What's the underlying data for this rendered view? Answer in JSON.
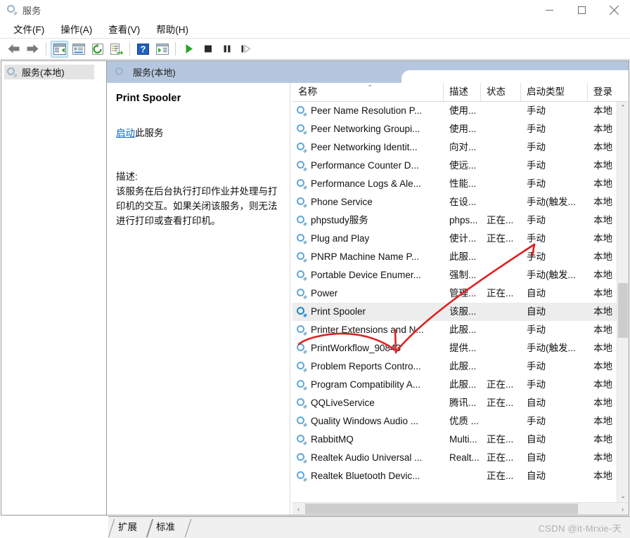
{
  "window": {
    "title": "服务",
    "icon": "gear-icon",
    "minimize_label": "最小化",
    "maximize_label": "最大化",
    "close_label": "关闭"
  },
  "menubar": {
    "items": [
      {
        "label": "文件(F)",
        "name": "menu-file"
      },
      {
        "label": "操作(A)",
        "name": "menu-action"
      },
      {
        "label": "查看(V)",
        "name": "menu-view"
      },
      {
        "label": "帮助(H)",
        "name": "menu-help"
      }
    ]
  },
  "toolbar": {
    "buttons": [
      {
        "icon": "back-arrow-icon",
        "label": "后退"
      },
      {
        "icon": "forward-arrow-icon",
        "label": "前进"
      },
      {
        "icon": "show-hide-tree-icon",
        "label": "显示/隐藏控制台树"
      },
      {
        "icon": "properties-icon",
        "label": "属性"
      },
      {
        "icon": "refresh-icon",
        "label": "刷新"
      },
      {
        "icon": "export-list-icon",
        "label": "导出列表"
      },
      {
        "icon": "help-icon",
        "label": "帮助"
      },
      {
        "icon": "show-action-pane-icon",
        "label": "显示/隐藏操作窗格"
      },
      {
        "icon": "start-service-icon",
        "label": "启动服务"
      },
      {
        "icon": "stop-service-icon",
        "label": "停止服务"
      },
      {
        "icon": "pause-service-icon",
        "label": "暂停服务"
      },
      {
        "icon": "restart-service-icon",
        "label": "重启服务"
      }
    ]
  },
  "sidebar": {
    "items": [
      {
        "label": "服务(本地)",
        "icon": "gear-icon",
        "selected": true
      }
    ]
  },
  "pane": {
    "header_title": "服务(本地)",
    "header_icon": "gear-icon"
  },
  "detail": {
    "service_name": "Print Spooler",
    "action_link": "启动",
    "action_suffix": "此服务",
    "description_label": "描述:",
    "description_text": "该服务在后台执行打印作业并处理与打印机的交互。如果关闭该服务，则无法进行打印或查看打印机。"
  },
  "list": {
    "columns": [
      {
        "key": "name",
        "label": "名称",
        "sorted": true,
        "sort_caret": "⌃"
      },
      {
        "key": "desc",
        "label": "描述"
      },
      {
        "key": "state",
        "label": "状态"
      },
      {
        "key": "start",
        "label": "启动类型"
      },
      {
        "key": "logon",
        "label": "登录"
      }
    ],
    "rows": [
      {
        "name": "Peer Name Resolution P...",
        "desc": "使用...",
        "state": "",
        "start": "手动",
        "logon": "本地",
        "selected": false
      },
      {
        "name": "Peer Networking Groupi...",
        "desc": "使用...",
        "state": "",
        "start": "手动",
        "logon": "本地",
        "selected": false
      },
      {
        "name": "Peer Networking Identit...",
        "desc": "向对...",
        "state": "",
        "start": "手动",
        "logon": "本地",
        "selected": false
      },
      {
        "name": "Performance Counter D...",
        "desc": "使远...",
        "state": "",
        "start": "手动",
        "logon": "本地",
        "selected": false
      },
      {
        "name": "Performance Logs & Ale...",
        "desc": "性能...",
        "state": "",
        "start": "手动",
        "logon": "本地",
        "selected": false
      },
      {
        "name": "Phone Service",
        "desc": "在设...",
        "state": "",
        "start": "手动(触发...",
        "logon": "本地",
        "selected": false
      },
      {
        "name": "phpstudy服务",
        "desc": "phps...",
        "state": "正在...",
        "start": "手动",
        "logon": "本地",
        "selected": false
      },
      {
        "name": "Plug and Play",
        "desc": "使计...",
        "state": "正在...",
        "start": "手动",
        "logon": "本地",
        "selected": false
      },
      {
        "name": "PNRP Machine Name P...",
        "desc": "此服...",
        "state": "",
        "start": "手动",
        "logon": "本地",
        "selected": false
      },
      {
        "name": "Portable Device Enumer...",
        "desc": "强制...",
        "state": "",
        "start": "手动(触发...",
        "logon": "本地",
        "selected": false
      },
      {
        "name": "Power",
        "desc": "管理...",
        "state": "正在...",
        "start": "自动",
        "logon": "本地",
        "selected": false
      },
      {
        "name": "Print Spooler",
        "desc": "该服...",
        "state": "",
        "start": "自动",
        "logon": "本地",
        "selected": true
      },
      {
        "name": "Printer Extensions and N...",
        "desc": "此服...",
        "state": "",
        "start": "手动",
        "logon": "本地",
        "selected": false
      },
      {
        "name": "PrintWorkflow_90843",
        "desc": "提供...",
        "state": "",
        "start": "手动(触发...",
        "logon": "本地",
        "selected": false
      },
      {
        "name": "Problem Reports Contro...",
        "desc": "此服...",
        "state": "",
        "start": "手动",
        "logon": "本地",
        "selected": false
      },
      {
        "name": "Program Compatibility A...",
        "desc": "此服...",
        "state": "正在...",
        "start": "手动",
        "logon": "本地",
        "selected": false
      },
      {
        "name": "QQLiveService",
        "desc": "腾讯...",
        "state": "正在...",
        "start": "自动",
        "logon": "本地",
        "selected": false
      },
      {
        "name": "Quality Windows Audio ...",
        "desc": "优质 ...",
        "state": "",
        "start": "手动",
        "logon": "本地",
        "selected": false
      },
      {
        "name": "RabbitMQ",
        "desc": "Multi...",
        "state": "正在...",
        "start": "自动",
        "logon": "本地",
        "selected": false
      },
      {
        "name": "Realtek Audio Universal ...",
        "desc": "Realt...",
        "state": "正在...",
        "start": "自动",
        "logon": "本地",
        "selected": false
      },
      {
        "name": "Realtek Bluetooth Devic...",
        "desc": "",
        "state": "正在...",
        "start": "自动",
        "logon": "本地",
        "selected": false
      }
    ]
  },
  "scrollbars": {
    "vertical_up": "⌃",
    "vertical_down": "⌄",
    "horizontal_left": "‹",
    "horizontal_right": "›"
  },
  "tabs": [
    {
      "label": "扩展",
      "name": "tab-extended"
    },
    {
      "label": "标准",
      "name": "tab-standard",
      "active": true
    }
  ],
  "watermark": "CSDN @it-Mrxie-天",
  "annotation": {
    "color": "#e02020",
    "description": "红色手绘箭头，从 Print Spooler 行指向启动类型列"
  },
  "colors": {
    "pane_header": "#b5c7de",
    "selection": "#ededed",
    "link": "#0066cc",
    "annotation_red": "#e02020"
  }
}
